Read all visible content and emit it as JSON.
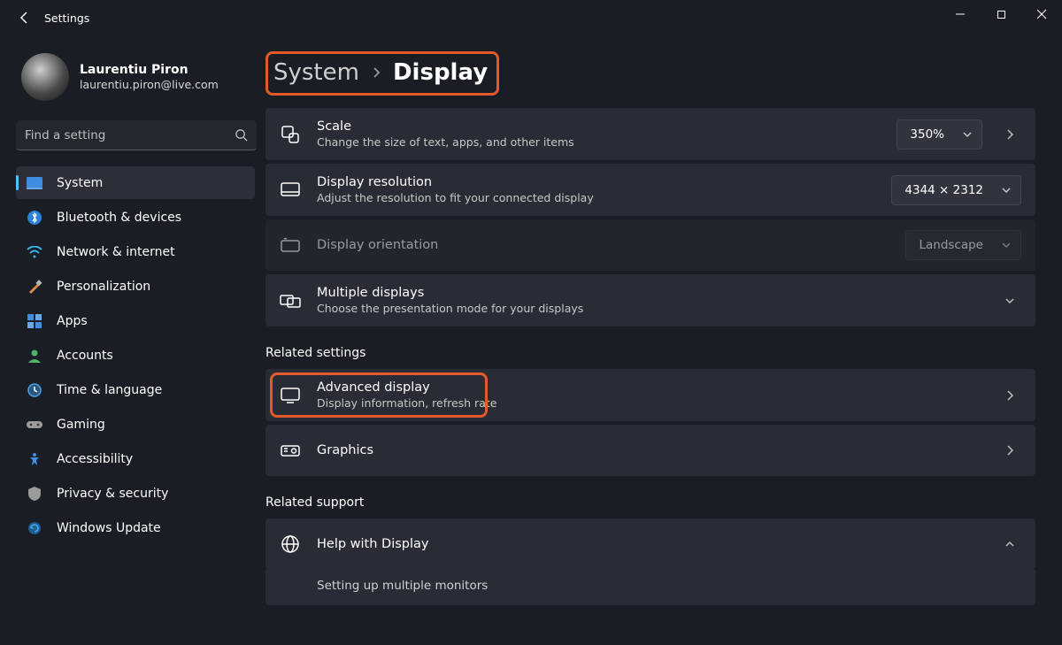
{
  "app_title": "Settings",
  "profile": {
    "name": "Laurentiu Piron",
    "email": "laurentiu.piron@live.com"
  },
  "search": {
    "placeholder": "Find a setting"
  },
  "nav": [
    {
      "label": "System",
      "active": true
    },
    {
      "label": "Bluetooth & devices"
    },
    {
      "label": "Network & internet"
    },
    {
      "label": "Personalization"
    },
    {
      "label": "Apps"
    },
    {
      "label": "Accounts"
    },
    {
      "label": "Time & language"
    },
    {
      "label": "Gaming"
    },
    {
      "label": "Accessibility"
    },
    {
      "label": "Privacy & security"
    },
    {
      "label": "Windows Update"
    }
  ],
  "breadcrumb": {
    "level1": "System",
    "level2": "Display"
  },
  "settings": {
    "scale": {
      "title": "Scale",
      "sub": "Change the size of text, apps, and other items",
      "value": "350%"
    },
    "resolution": {
      "title": "Display resolution",
      "sub": "Adjust the resolution to fit your connected display",
      "value": "4344 × 2312"
    },
    "orientation": {
      "title": "Display orientation",
      "value": "Landscape"
    },
    "multiple": {
      "title": "Multiple displays",
      "sub": "Choose the presentation mode for your displays"
    }
  },
  "related_settings_label": "Related settings",
  "related": {
    "advanced": {
      "title": "Advanced display",
      "sub": "Display information, refresh rate"
    },
    "graphics": {
      "title": "Graphics"
    }
  },
  "related_support_label": "Related support",
  "support": {
    "help": {
      "title": "Help with Display"
    },
    "multi": {
      "title": "Setting up multiple monitors"
    }
  }
}
